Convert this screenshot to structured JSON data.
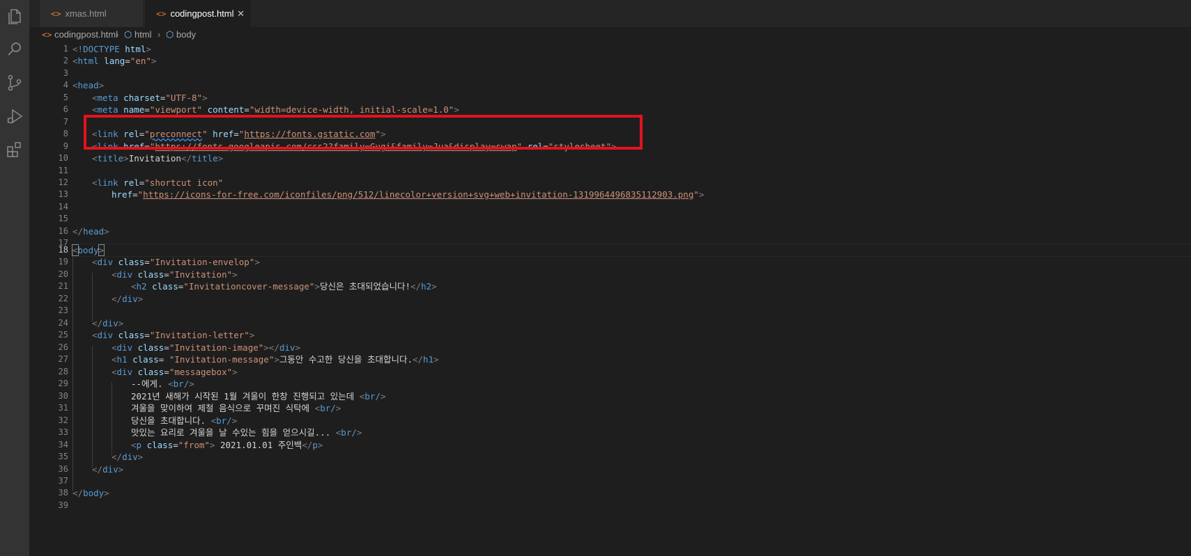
{
  "tabs": [
    {
      "label": "xmas.html",
      "icon": "html-file-icon",
      "active": false
    },
    {
      "label": "codingpost.html",
      "icon": "html-file-icon",
      "active": true,
      "close": "✕"
    }
  ],
  "breadcrumb": {
    "file": "codingpost.html",
    "items": [
      "html",
      "body"
    ],
    "separator": "›"
  },
  "activity_bar": [
    "explorer-icon",
    "search-icon",
    "source-control-icon",
    "run-debug-icon",
    "extensions-icon"
  ],
  "editor": {
    "current_line": 18,
    "line_numbers": [
      "1",
      "2",
      "3",
      "4",
      "5",
      "6",
      "7",
      "8",
      "9",
      "10",
      "11",
      "12",
      "13",
      "14",
      "15",
      "16",
      "17",
      "18",
      "19",
      "20",
      "21",
      "22",
      "23",
      "24",
      "25",
      "26",
      "27",
      "28",
      "29",
      "30",
      "31",
      "32",
      "33",
      "34",
      "35",
      "36",
      "37",
      "38",
      "39"
    ],
    "tokens": {
      "l1_a": "<!",
      "l1_b": "DOCTYPE",
      "l1_c": " html",
      "l1_d": ">",
      "l2_tag": "html",
      "l2_attr": "lang",
      "l2_val": "\"en\"",
      "l4_tag": "head",
      "l5_tag": "meta",
      "l5_attr": "charset",
      "l5_val": "\"UTF-8\"",
      "l6_tag": "meta",
      "l6_attr1": "name",
      "l6_val1": "\"viewport\"",
      "l6_attr2": "content",
      "l6_val2": "\"width=device-width, initial-scale=1.0\"",
      "l8_tag": "link",
      "l8_attr1": "rel",
      "l8_q1": "\"",
      "l8_val1": "preconnect",
      "l8_q2": "\"",
      "l8_attr2": "href",
      "l8_url": "https://fonts.gstatic.com",
      "l9_tag": "link",
      "l9_attr1": "href",
      "l9_url": "https://fonts.googleapis.com/css2?family=Gugi&family=Jua&display=swap",
      "l9_attr2": "rel",
      "l9_val2": "\"stylesheet\"",
      "l10_tag": "title",
      "l10_text": "Invitation",
      "l12_tag": "link",
      "l12_attr": "rel",
      "l12_val": "\"shortcut icon\"",
      "l13_attr": "href",
      "l13_url": "https://icons-for-free.com/iconfiles/png/512/linecolor+version+svg+web+invitation-1319964496835112903.png",
      "l16_tag": "head",
      "l18_tag": "body",
      "l19_tag": "div",
      "l19_attr": "class",
      "l19_val": "\"Invitation-envelop\"",
      "l20_tag": "div",
      "l20_attr": "class",
      "l20_val": "\"Invitation\"",
      "l21_tag": "h2",
      "l21_attr": "class",
      "l21_val": "\"Invitationcover-message\"",
      "l21_text": "당신은 초대되었습니다!",
      "l22_tag": "div",
      "l24_tag": "div",
      "l25_tag": "div",
      "l25_attr": "class",
      "l25_val": "\"Invitation-letter\"",
      "l26_tag": "div",
      "l26_attr": "class",
      "l26_val": "\"Invitation-image\"",
      "l27_tag": "h1",
      "l27_attr": "class",
      "l27_val": " \"Invitation-message\"",
      "l27_text": "그동안 수고한 당신을 초대합니다.",
      "l28_tag": "div",
      "l28_attr": "class",
      "l28_val": "\"messagebox\"",
      "l29_text": "--에게. ",
      "l30_text": "2021년 새해가 시작된 1월 겨울이 한창 진행되고 있는데 ",
      "l31_text": "겨울을 맞이하여 제철 음식으로 꾸며진 식탁에 ",
      "l32_text": "당신을 초대합니다. ",
      "l33_text": "맛있는 요리로 겨울을 날 수있는 힘을 얻으시길... ",
      "br": "br/",
      "l34_tag": "p",
      "l34_attr": "class",
      "l34_val": "\"from\"",
      "l34_text": " 2021.01.01 주인백",
      "l35_tag": "div",
      "l36_tag": "div",
      "l38_tag": "body"
    }
  }
}
